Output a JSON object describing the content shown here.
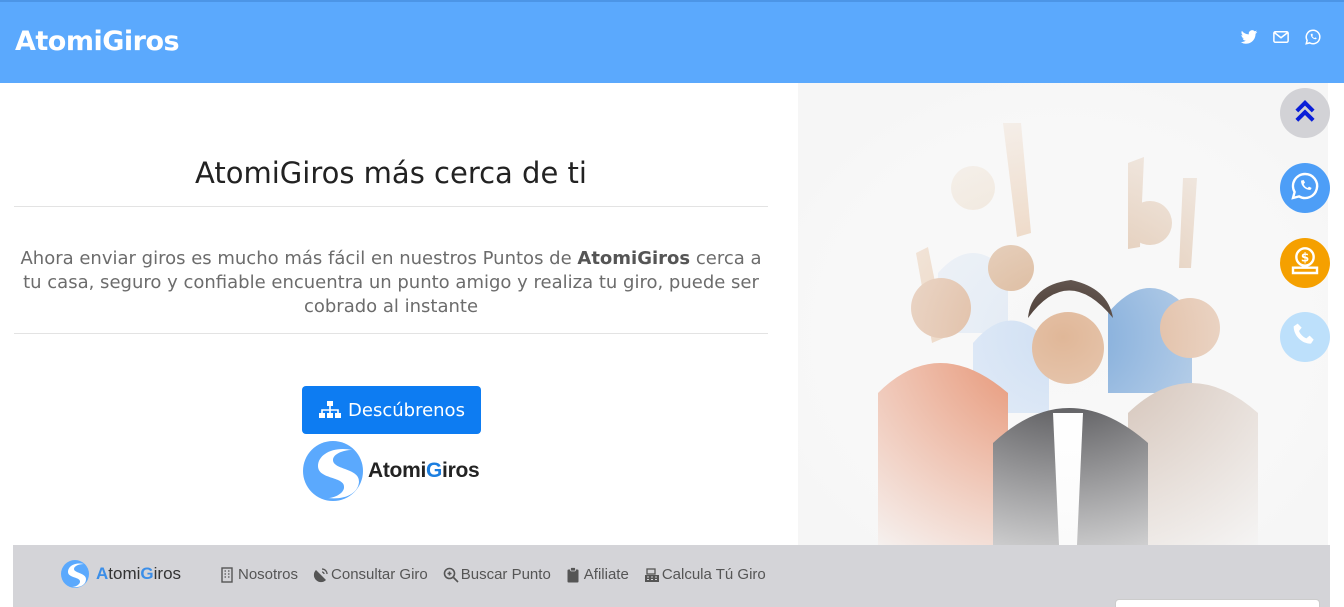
{
  "header": {
    "brand": "AtomiGiros",
    "social_icons": [
      "twitter-icon",
      "envelope-icon",
      "whatsapp-icon"
    ]
  },
  "hero": {
    "title": "AtomiGiros más cerca de ti",
    "text_before": "Ahora enviar giros es mucho más fácil en nuestros Puntos de ",
    "text_bold": "AtomiGiros",
    "text_after": " cerca a tu casa, seguro y confiable encuentra un punto amigo y realiza tu giro, puede ser cobrado al instante",
    "button_label": "Descúbrenos",
    "logo_text_start": "Atomi",
    "logo_text_g": "G",
    "logo_text_end": "iros"
  },
  "floating_buttons": [
    {
      "name": "scroll-top",
      "icon": "double-chevron-up-icon"
    },
    {
      "name": "whatsapp",
      "icon": "whatsapp-icon"
    },
    {
      "name": "money",
      "icon": "money-icon"
    },
    {
      "name": "phone",
      "icon": "phone-icon"
    }
  ],
  "footer": {
    "brand_a": "A",
    "brand_tomi": "tomi",
    "brand_g": "G",
    "brand_iros": "iros",
    "nav": [
      {
        "label": "Nosotros",
        "icon": "building-icon"
      },
      {
        "label": "Consultar Giro",
        "icon": "satellite-icon"
      },
      {
        "label": "Buscar Punto",
        "icon": "search-plus-icon"
      },
      {
        "label": "Afiliate",
        "icon": "clipboard-icon"
      },
      {
        "label": "Calcula Tú Giro",
        "icon": "cash-register-icon"
      }
    ]
  },
  "colors": {
    "header_bg": "#5ba9fd",
    "button_bg": "#0d7cf2",
    "footer_bg": "#d4d4d8",
    "float_top": "#d2d2d6",
    "float_whatsapp": "#4d9ef7",
    "float_money": "#f5a000",
    "float_phone": "#bde0fb"
  }
}
